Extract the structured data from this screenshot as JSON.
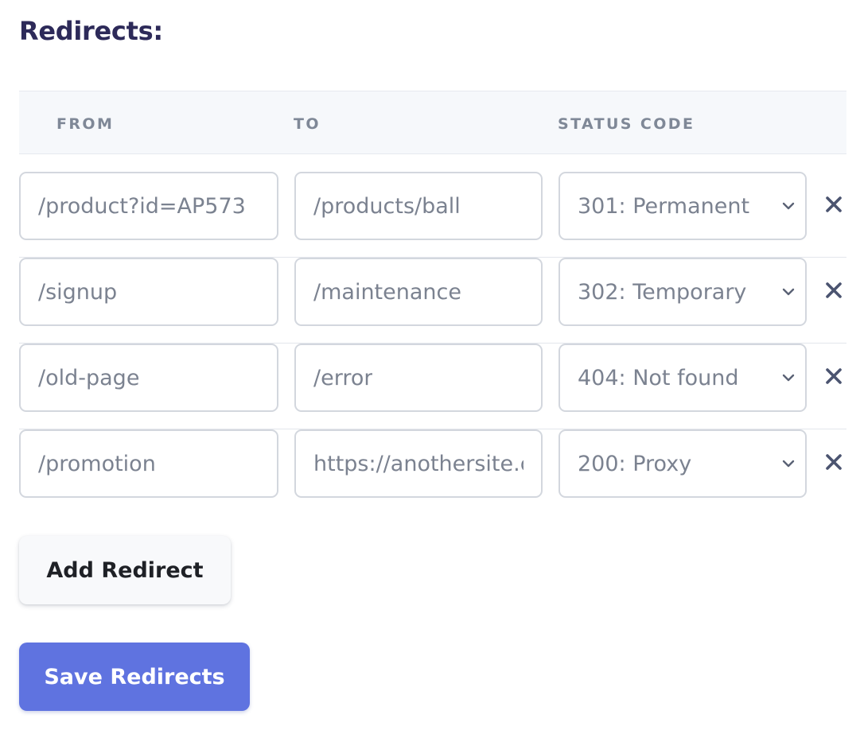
{
  "section": {
    "title": "Redirects:"
  },
  "table": {
    "headers": {
      "from": "FROM",
      "to": "TO",
      "status": "STATUS CODE"
    },
    "rows": [
      {
        "from": "/product?id=AP573",
        "to": "/products/ball",
        "status": "301: Permanent"
      },
      {
        "from": "/signup",
        "to": "/maintenance",
        "status": "302: Temporary"
      },
      {
        "from": "/old-page",
        "to": "/error",
        "status": "404: Not found"
      },
      {
        "from": "/promotion",
        "to": "https://anothersite.com",
        "status": "200: Proxy"
      }
    ]
  },
  "buttons": {
    "add_label": "Add Redirect",
    "save_label": "Save Redirects"
  },
  "icons": {
    "remove": "close-icon",
    "dropdown": "chevron-down-icon"
  },
  "colors": {
    "title": "#2d2a59",
    "header_bg": "#f6f8fb",
    "header_text": "#7f8897",
    "field_border": "#d3d7de",
    "field_text": "#7b8290",
    "remove_icon": "#4b5470",
    "primary": "#5f73e0",
    "secondary_bg": "#f8f9fb"
  }
}
